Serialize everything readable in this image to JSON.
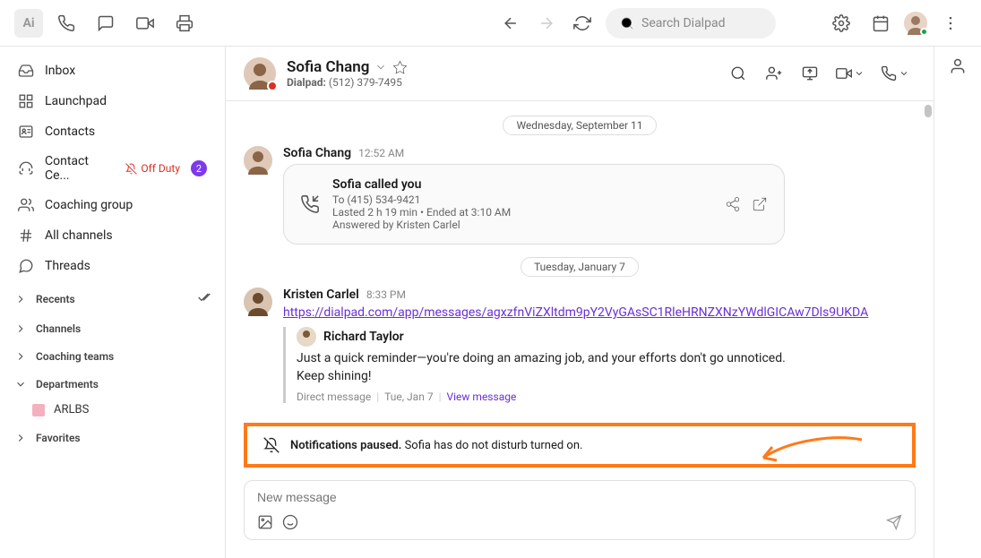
{
  "search": {
    "placeholder": "Search Dialpad"
  },
  "sidebar": {
    "items": [
      {
        "label": "Inbox"
      },
      {
        "label": "Launchpad"
      },
      {
        "label": "Contacts"
      },
      {
        "label": "Contact Ce...",
        "extra": "Off Duty",
        "badge": "2"
      },
      {
        "label": "Coaching group"
      },
      {
        "label": "All channels"
      },
      {
        "label": "Threads"
      }
    ],
    "sections": [
      {
        "label": "Recents"
      },
      {
        "label": "Channels"
      },
      {
        "label": "Coaching teams"
      },
      {
        "label": "Departments",
        "sub": "ARLBS"
      },
      {
        "label": "Favorites"
      }
    ]
  },
  "chat": {
    "title": "Sofia Chang",
    "subtitle_label": "Dialpad:",
    "subtitle_value": "(512) 379-7495"
  },
  "messages": {
    "divider1": "Wednesday, September 11",
    "msg1": {
      "sender": "Sofia Chang",
      "time": "12:52 AM"
    },
    "call": {
      "title": "Sofia called you",
      "to": "To (415) 534-9421",
      "duration": "Lasted 2 h 19 min • Ended at 3:10 AM",
      "answered": "Answered by Kristen Carlel"
    },
    "divider2": "Tuesday, January 7",
    "msg2": {
      "sender": "Kristen Carlel",
      "time": "8:33 PM",
      "link": "https://dialpad.com/app/messages/agxzfnViZXltdm9pY2VyGAsSC1RleHRNZXNzYWdlGICAw7Dls9UKDA"
    },
    "quote": {
      "name": "Richard Taylor",
      "text1": "Just a quick reminder—you're doing an amazing job, and your efforts don't go unnoticed.",
      "text2": "Keep shining!",
      "meta1": "Direct message",
      "meta2": "Tue, Jan 7",
      "action": "View message"
    }
  },
  "dnd": {
    "bold": "Notifications paused.",
    "rest": " Sofia has do not disturb turned on."
  },
  "composer": {
    "placeholder": "New message"
  }
}
